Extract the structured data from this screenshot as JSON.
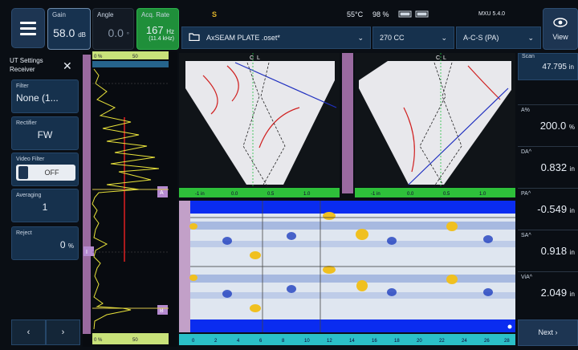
{
  "top": {
    "gain": {
      "label": "Gain",
      "value": "58.0",
      "unit": "dB"
    },
    "angle": {
      "label": "Angle",
      "value": "0.0",
      "unit": "°"
    },
    "acq": {
      "label": "Acq. Rate",
      "value": "167",
      "unit": "Hz",
      "sub": "(11.4 kHz)"
    },
    "status": {
      "indicator": "S",
      "temperature": "55°C",
      "battery": "98 %",
      "icons": "A B",
      "version": "MXU 5.4.0"
    },
    "view_label": "View",
    "file_select": "AxSEAM PLATE .oset*",
    "probe_select": "270 CC",
    "group_select": "A-C-S (PA)"
  },
  "left": {
    "header": "UT Settings",
    "subheader": "Receiver",
    "close": "✕",
    "filter": {
      "label": "Filter",
      "value": "None (1..."
    },
    "rectifier": {
      "label": "Rectifier",
      "value": "FW"
    },
    "video_filter": {
      "label": "Video Filter",
      "value": "OFF"
    },
    "averaging": {
      "label": "Averaging",
      "value": "1"
    },
    "reject": {
      "label": "Reject",
      "value": "0",
      "unit": "%"
    },
    "prev": "‹",
    "next": "›"
  },
  "ascan": {
    "top_ruler": [
      "0 %",
      "50"
    ],
    "bottom_ruler": [
      "0 %",
      "50"
    ],
    "gate_labels": [
      "A",
      "I",
      "B",
      "R",
      "I"
    ]
  },
  "imaging": {
    "scan_labels": [
      "C",
      "L"
    ],
    "index_ruler": [
      "-1 in",
      "0.0",
      "0.5",
      "1.0"
    ],
    "scan_ruler": [
      "0",
      "2",
      "4",
      "6",
      "8",
      "10",
      "12",
      "14",
      "16",
      "18",
      "20",
      "22",
      "24",
      "26",
      "28"
    ]
  },
  "right": {
    "scan": {
      "label": "Scan",
      "value": "47.795",
      "unit": "in"
    },
    "a_pct": {
      "label": "A%",
      "value": "200.0",
      "unit": "%"
    },
    "da": {
      "label": "DA^",
      "value": "0.832",
      "unit": "in"
    },
    "pa": {
      "label": "PA^",
      "value": "-0.549",
      "unit": "in"
    },
    "sa": {
      "label": "SA^",
      "value": "0.918",
      "unit": "in"
    },
    "via": {
      "label": "ViA^",
      "value": "2.049",
      "unit": "in"
    },
    "next": "Next ›"
  },
  "colors": {
    "accent": "#1d3552",
    "acq": "#1f8f3a",
    "gate": "#e0b42a",
    "cscan": "#0033ff"
  }
}
